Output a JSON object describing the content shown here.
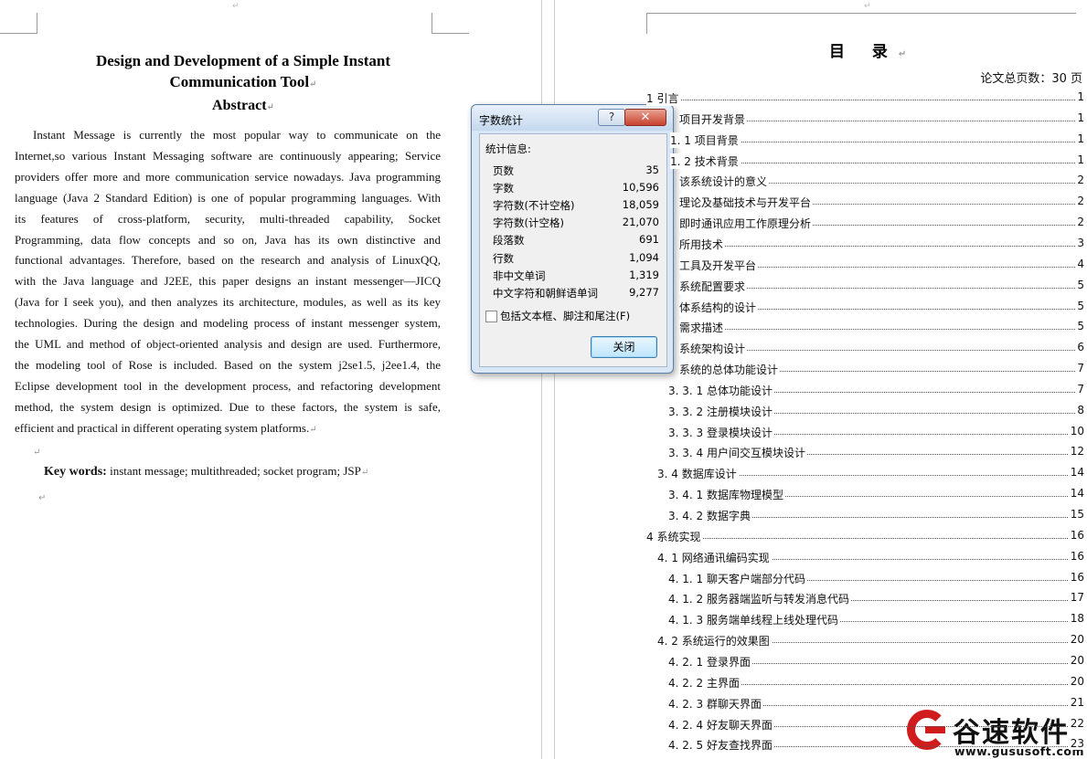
{
  "left_page": {
    "title": "Design and Development of a Simple Instant Communication Tool",
    "title_line1": "Design and Development of a Simple Instant",
    "title_line2": "Communication Tool",
    "abstract_heading": "Abstract",
    "abstract_lines": [
      "Instant Message is currently the most popular way to communicate on the",
      "Internet,so various Instant Messaging software are continuously appearing; Service",
      "providers offer more and more communication service nowadays. Java programming",
      "language (Java 2 Standard Edition) is one of popular programming languages. With",
      "its features of cross-platform, security, multi-threaded capability, Socket",
      "Programming, data flow concepts and so on, Java has its own distinctive and",
      "functional advantages. Therefore, based on the research and analysis of LinuxQQ,",
      "with the Java language and J2EE, this paper designs an instant messenger—JICQ",
      "(Java for I seek you), and then analyzes its architecture, modules, as well as its key",
      "technologies. During the design and modeling process of instant messenger system,",
      "the UML and method of object-oriented analysis and design are used. Furthermore,",
      "the modeling tool of Rose is included. Based on the system j2se1.5, j2ee1.4, the",
      "Eclipse development tool in the development process, and refactoring development",
      "method, the system design is optimized. Due to these factors, the system is safe,",
      "efficient and practical in different operating system platforms."
    ],
    "keywords_label": "Key words:",
    "keywords_value": "instant message; multithreaded; socket program; JSP"
  },
  "right_page": {
    "toc_title": "目 录",
    "total_pages_text": "论文总页数：30 页",
    "toc": [
      {
        "text": "1 引言",
        "page": "1"
      },
      {
        "text": "项目开发背景",
        "page": "1"
      },
      {
        "text": "1. 1 项目背景",
        "page": "1"
      },
      {
        "text": "1. 2 技术背景",
        "page": "1"
      },
      {
        "text": "该系统设计的意义",
        "page": "2"
      },
      {
        "text": "理论及基础技术与开发平台",
        "page": "2"
      },
      {
        "text": "即时通讯应用工作原理分析",
        "page": "2"
      },
      {
        "text": "所用技术",
        "page": "3"
      },
      {
        "text": "工具及开发平台",
        "page": "4"
      },
      {
        "text": "系统配置要求",
        "page": "5"
      },
      {
        "text": "体系结构的设计",
        "page": "5"
      },
      {
        "text": "需求描述",
        "page": "5"
      },
      {
        "text": "系统架构设计",
        "page": "6"
      },
      {
        "text": "系统的总体功能设计",
        "page": "7"
      },
      {
        "text": "3. 3. 1 总体功能设计",
        "page": "7"
      },
      {
        "text": "3. 3. 2 注册模块设计",
        "page": "8"
      },
      {
        "text": "3. 3. 3 登录模块设计",
        "page": "10"
      },
      {
        "text": "3. 3. 4 用户间交互模块设计",
        "page": "12"
      },
      {
        "text": "3. 4 数据库设计",
        "page": "14"
      },
      {
        "text": "3. 4. 1 数据库物理模型",
        "page": "14"
      },
      {
        "text": "3. 4. 2 数据字典",
        "page": "15"
      },
      {
        "text": "4 系统实现",
        "page": "16"
      },
      {
        "text": "4. 1 网络通讯编码实现",
        "page": "16"
      },
      {
        "text": "4. 1. 1 聊天客户端部分代码",
        "page": "16"
      },
      {
        "text": "4. 1. 2 服务器端监听与转发消息代码",
        "page": "17"
      },
      {
        "text": "4. 1. 3 服务端单线程上线处理代码",
        "page": "18"
      },
      {
        "text": "4. 2 系统运行的效果图",
        "page": "20"
      },
      {
        "text": "4. 2. 1 登录界面",
        "page": "20"
      },
      {
        "text": "4. 2. 2 主界面",
        "page": "20"
      },
      {
        "text": "4. 2. 3 群聊天界面",
        "page": "21"
      },
      {
        "text": "4. 2. 4 好友聊天界面",
        "page": "22"
      },
      {
        "text": "4. 2. 5 好友查找界面",
        "page": "23"
      }
    ]
  },
  "dialog": {
    "title": "字数统计",
    "help_label": "?",
    "close_x_label": "✕",
    "stats_label": "统计信息:",
    "stats": [
      {
        "label": "页数",
        "value": "35"
      },
      {
        "label": "字数",
        "value": "10,596"
      },
      {
        "label": "字符数(不计空格)",
        "value": "18,059"
      },
      {
        "label": "字符数(计空格)",
        "value": "21,070"
      },
      {
        "label": "段落数",
        "value": "691"
      },
      {
        "label": "行数",
        "value": "1,094"
      },
      {
        "label": "非中文单词",
        "value": "1,319"
      },
      {
        "label": "中文字符和朝鲜语单词",
        "value": "9,277"
      }
    ],
    "include_label": "包括文本框、脚注和尾注(F)",
    "include_checked": false,
    "close_button_label": "关闭"
  },
  "watermark": {
    "name": "谷速软件",
    "url": "www.gususoft.com"
  }
}
